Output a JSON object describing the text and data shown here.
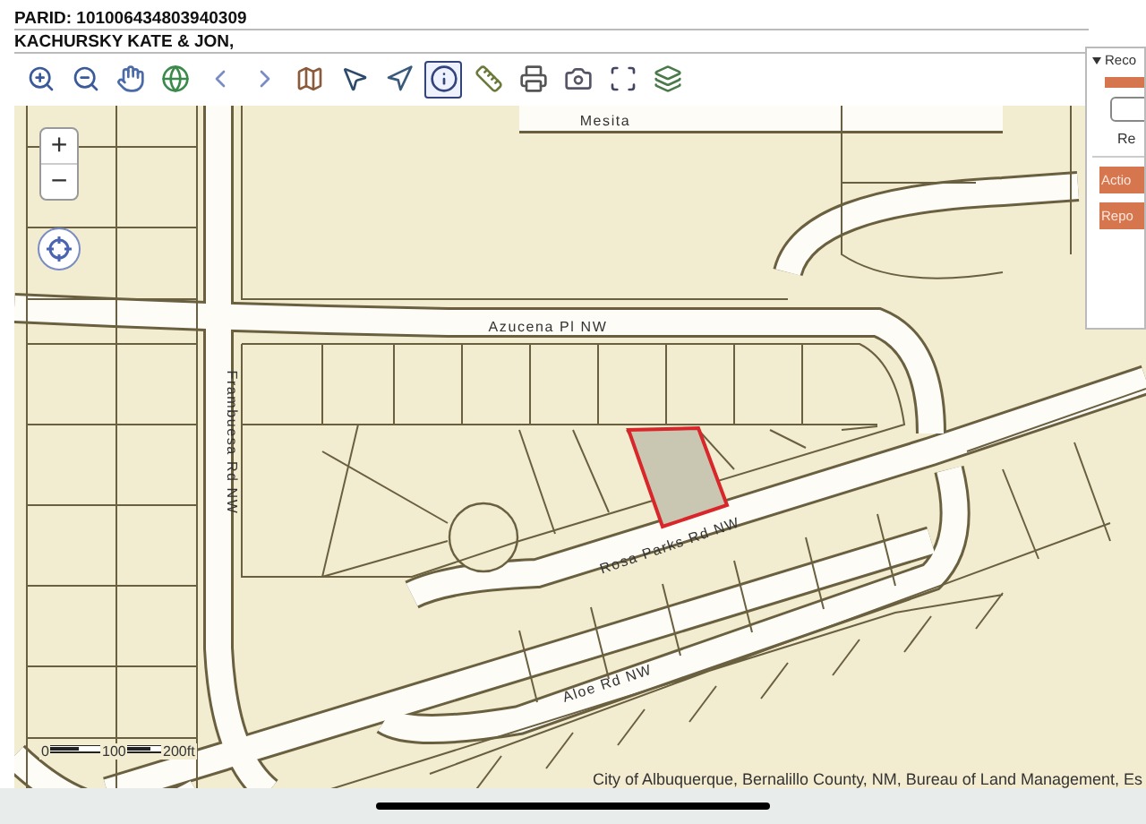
{
  "header": {
    "parid": "PARID: 101006434803940309",
    "owner": "KACHURSKY KATE & JON,"
  },
  "toolbar": {
    "tools": [
      {
        "kind": "zoom-in",
        "selected": false
      },
      {
        "kind": "zoom-out",
        "selected": false
      },
      {
        "kind": "pan",
        "selected": false
      },
      {
        "kind": "globe",
        "selected": false
      },
      {
        "kind": "back",
        "selected": false
      },
      {
        "kind": "forward",
        "selected": false
      },
      {
        "kind": "map",
        "selected": false
      },
      {
        "kind": "select",
        "selected": false
      },
      {
        "kind": "locate",
        "selected": false
      },
      {
        "kind": "info",
        "selected": true
      },
      {
        "kind": "measure",
        "selected": false
      },
      {
        "kind": "print",
        "selected": false
      },
      {
        "kind": "export",
        "selected": false
      },
      {
        "kind": "extent",
        "selected": false
      },
      {
        "kind": "layers",
        "selected": false
      }
    ]
  },
  "map": {
    "zoom_in": "+",
    "zoom_out": "−",
    "street_labels": [
      {
        "kind": "mesita",
        "text": "Mesita"
      },
      {
        "kind": "azucena",
        "text": "Azucena Pl NW"
      },
      {
        "kind": "frambuesa",
        "text": "Frambuesa Rd NW"
      },
      {
        "kind": "rosa",
        "text": "Rosa Parks Rd NW"
      },
      {
        "kind": "aloe",
        "text": "Aloe Rd NW"
      }
    ],
    "scale_labels": [
      "0",
      "100",
      "200ft"
    ],
    "attribution": "City of Albuquerque, Bernalillo County, NM, Bureau of Land Management, Es"
  },
  "panel": {
    "title": "Reco",
    "field_label": "Re",
    "buttons": [
      "Actio",
      "Repo"
    ]
  }
}
